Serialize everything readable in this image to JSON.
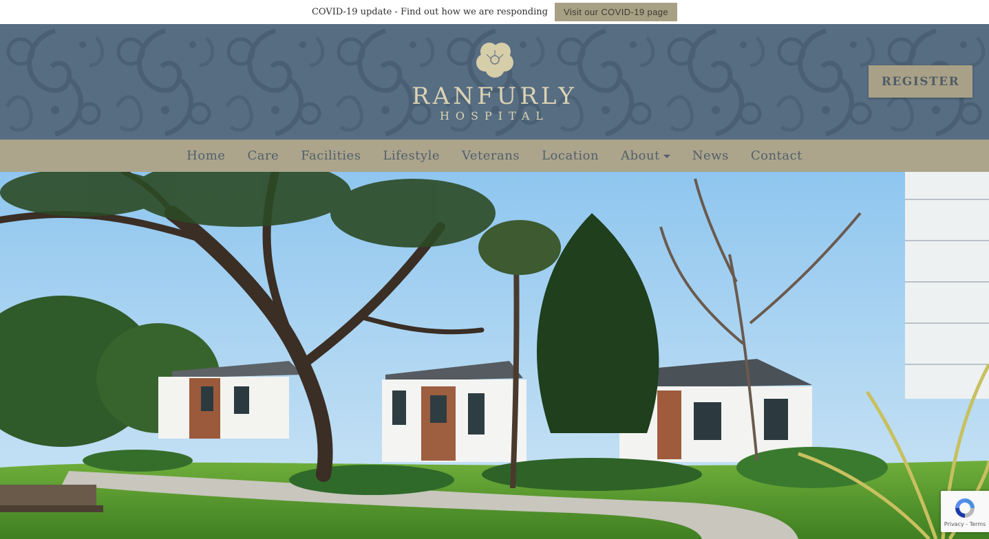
{
  "covid": {
    "text": "COVID-19 update - Find out how we are responding",
    "button": "Visit our COVID-19 page"
  },
  "header": {
    "logo_name": "RANFURLY",
    "logo_sub": "HOSPITAL",
    "register": "REGISTER",
    "logo_icon": "poppy-flower-icon"
  },
  "nav": {
    "items": [
      {
        "label": "Home"
      },
      {
        "label": "Care"
      },
      {
        "label": "Facilities"
      },
      {
        "label": "Lifestyle"
      },
      {
        "label": "Veterans"
      },
      {
        "label": "Location"
      },
      {
        "label": "About"
      },
      {
        "label": "News"
      },
      {
        "label": "Contact"
      }
    ]
  },
  "recaptcha": {
    "links": "Privacy - Terms",
    "icon": "recaptcha-icon"
  },
  "colors": {
    "header_bg": "#566d82",
    "nav_bg": "#aca58c",
    "accent": "#a9a187",
    "logo_text": "#dcd3b3"
  }
}
